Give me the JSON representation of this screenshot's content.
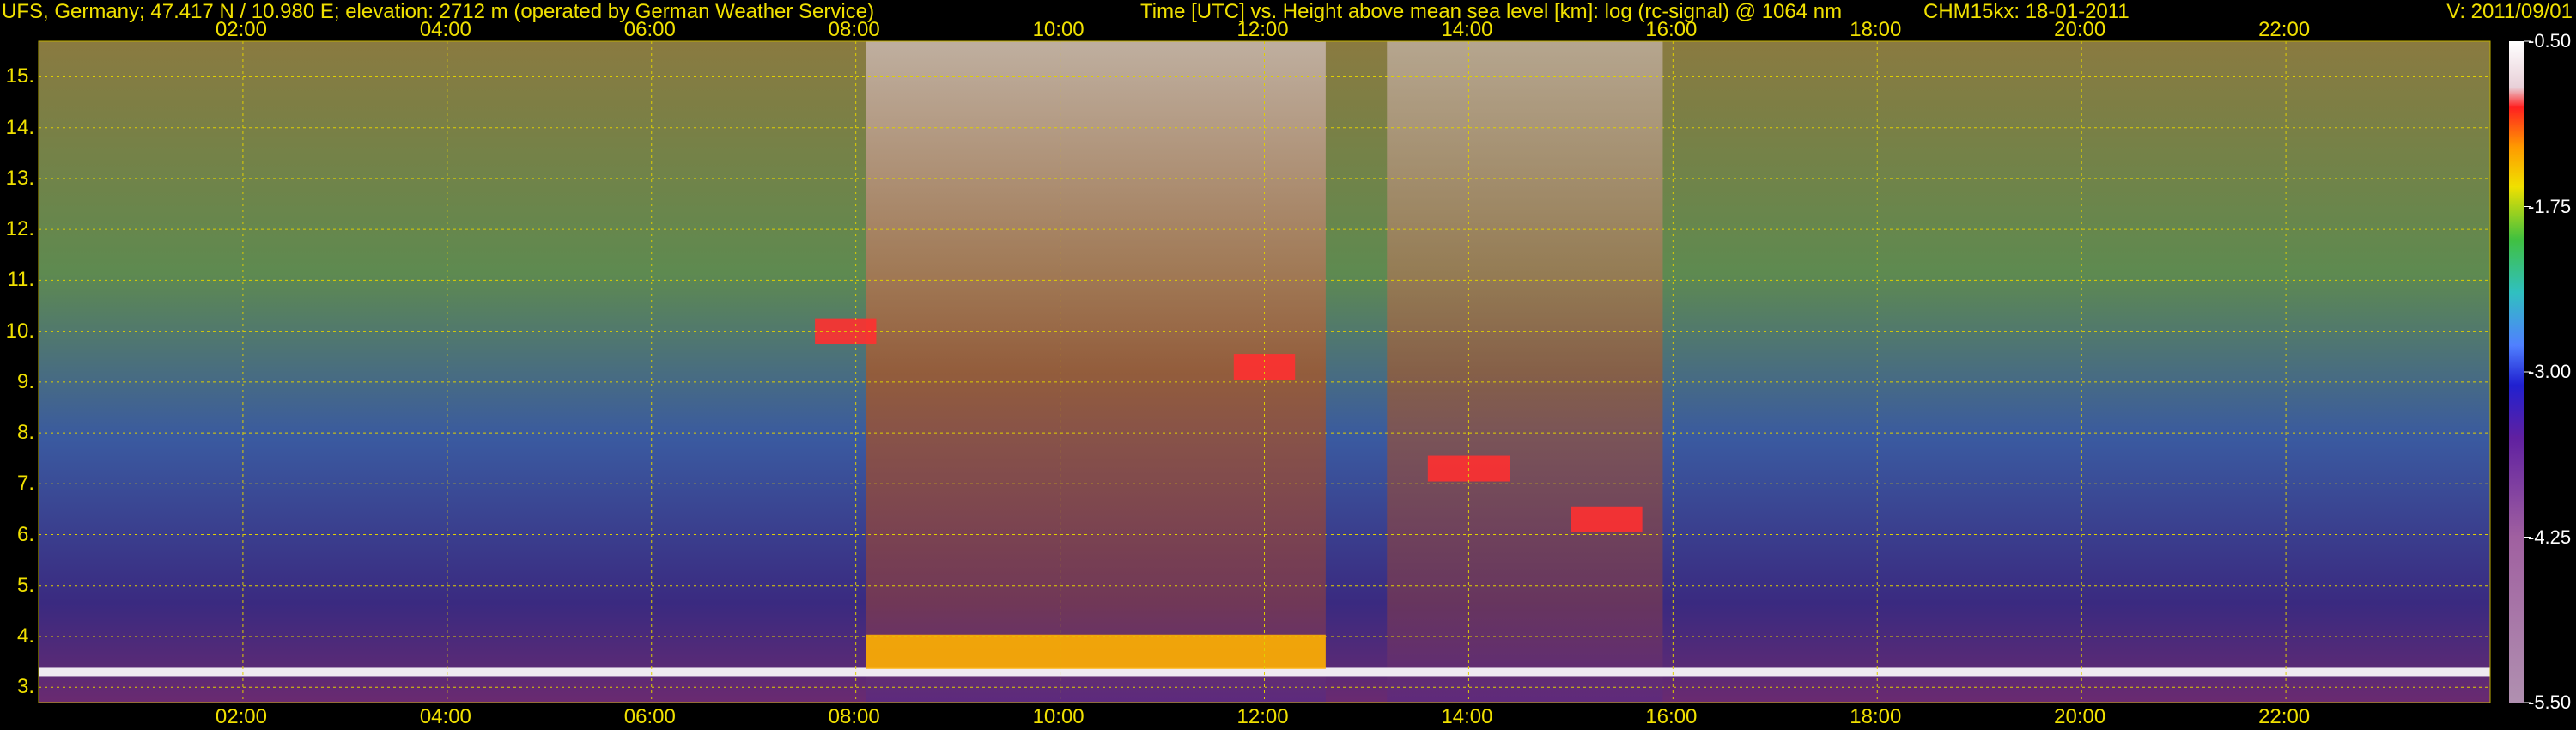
{
  "header": {
    "station": "UFS, Germany; 47.417 N / 10.980 E; elevation: 2712 m  (operated by German Weather Service)",
    "axes_title": "Time [UTC] vs. Height above mean sea level [km]: log (rc-signal) @ 1064 nm",
    "instrument_date": "CHM15kx: 18-01-2011",
    "version": "V: 2011/09/01"
  },
  "chart_data": {
    "type": "heatmap",
    "title": "Time [UTC] vs. Height above mean sea level [km]: log (rc-signal) @ 1064 nm",
    "xlabel": "Time [UTC]",
    "ylabel": "Height above mean sea level [km]",
    "x_ticks": [
      "02:00",
      "04:00",
      "06:00",
      "08:00",
      "10:00",
      "12:00",
      "14:00",
      "16:00",
      "18:00",
      "20:00",
      "22:00"
    ],
    "x_tick_hours": [
      2,
      4,
      6,
      8,
      10,
      12,
      14,
      16,
      18,
      20,
      22
    ],
    "xlim_hours": [
      0,
      24
    ],
    "y_ticks": [
      "3.",
      "4.",
      "5.",
      "6.",
      "7.",
      "8.",
      "9.",
      "10.",
      "11.",
      "12.",
      "13.",
      "14.",
      "15."
    ],
    "y_tick_values": [
      3,
      4,
      5,
      6,
      7,
      8,
      9,
      10,
      11,
      12,
      13,
      14,
      15
    ],
    "ylim_km": [
      2.7,
      15.7
    ],
    "grid": true,
    "colorbar": {
      "labels": [
        "-0.50",
        "-1.75",
        "-3.00",
        "-4.25",
        "-5.50"
      ],
      "values": [
        -0.5,
        -1.75,
        -3.0,
        -4.25,
        -5.5
      ],
      "range": [
        -5.5,
        -0.5
      ]
    },
    "features": [
      {
        "kind": "boundary_layer",
        "start_h": 0,
        "end_h": 24,
        "height_km": 3.3
      },
      {
        "kind": "cloud",
        "start_h": 7.6,
        "end_h": 8.2,
        "height_km": 10.0
      },
      {
        "kind": "cloud",
        "start_h": 11.7,
        "end_h": 12.3,
        "height_km": 9.3
      },
      {
        "kind": "cloud",
        "start_h": 13.6,
        "end_h": 14.4,
        "height_km": 7.3
      },
      {
        "kind": "cloud",
        "start_h": 15.0,
        "end_h": 15.7,
        "height_km": 6.3
      },
      {
        "kind": "low_layer",
        "start_h": 8.1,
        "end_h": 12.6,
        "height_km": 3.7
      }
    ]
  }
}
